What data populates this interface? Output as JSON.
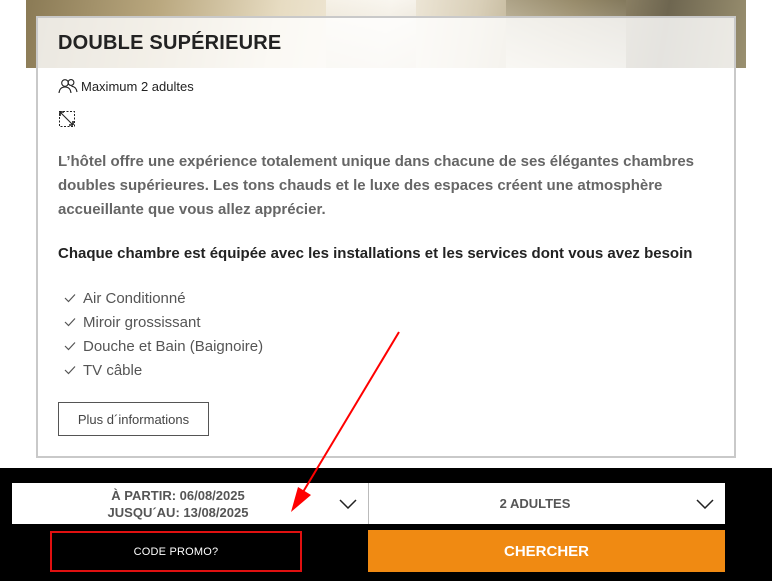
{
  "room": {
    "title": "DOUBLE SUPÉRIEURE",
    "capacity": "Maximum 2 adultes",
    "description": "L’hôtel offre une expérience totalement unique dans chacune de ses élégantes chambres doubles supérieures. Les tons chauds et le luxe des espaces créent une atmosphère accueillante que vous allez apprécier.",
    "equipment_title": "Chaque chambre est équipée avec les installations et les services dont vous avez besoin",
    "amenities": [
      "Air Conditionné",
      "Miroir grossissant",
      "Douche et Bain (Baignoire)",
      "TV câble"
    ],
    "more_button": "Plus d´informations"
  },
  "booking": {
    "date_from": "À PARTIR: 06/08/2025",
    "date_to": "JUSQU´AU: 13/08/2025",
    "guests": "2 ADULTES",
    "promo_label": "CODE PROMO?",
    "search_label": "CHERCHER"
  },
  "colors": {
    "accent": "#f08a12",
    "highlight": "#e01010",
    "bar": "#000000"
  },
  "icons": [
    "users-icon",
    "room-size-icon",
    "check-icon",
    "chevron-down-icon"
  ]
}
